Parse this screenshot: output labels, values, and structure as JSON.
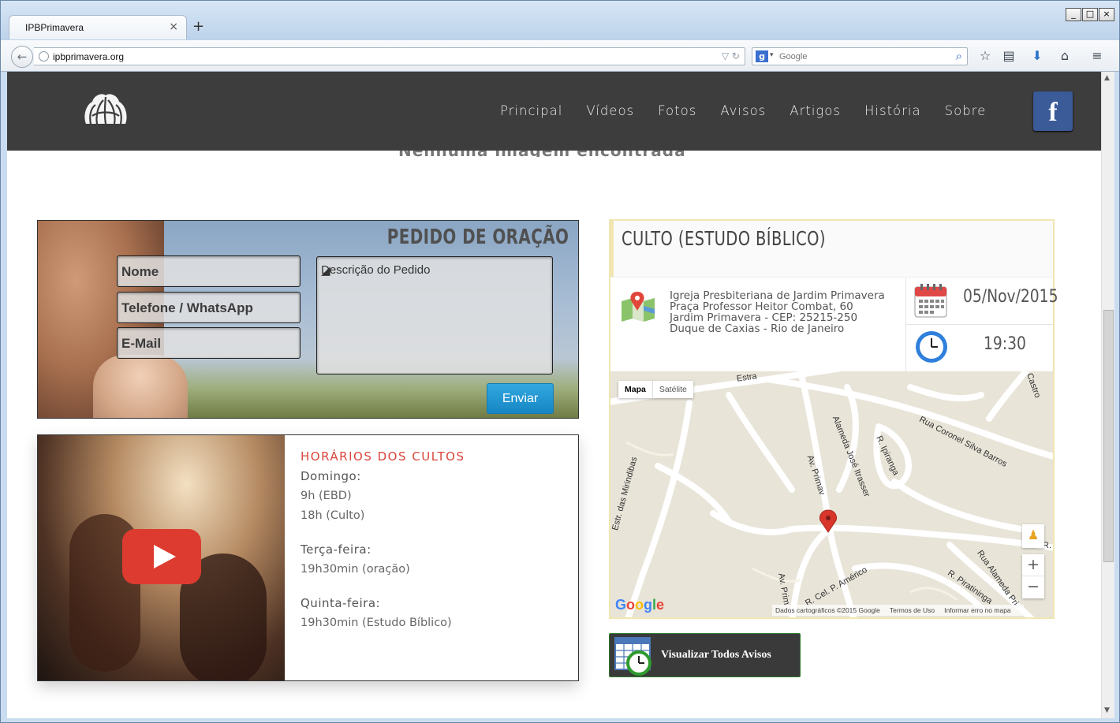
{
  "browser": {
    "tab_title": "IPBPrimavera",
    "tab_close": "×",
    "new_tab": "+",
    "url": "ipbprimavera.org",
    "search_engine": "g",
    "search_placeholder": "Google",
    "window_buttons": [
      "_",
      "□",
      "×"
    ]
  },
  "site": {
    "menu": [
      "Principal",
      "Vídeos",
      "Fotos",
      "Avisos",
      "Artigos",
      "História",
      "Sobre"
    ],
    "facebook": "f",
    "ghost_heading": "Nenhuma imagem encontrada"
  },
  "prayer": {
    "title": "PEDIDO DE ORAÇÃO",
    "name_placeholder": "Nome",
    "phone_placeholder": "Telefone / WhatsApp",
    "email_placeholder": "E-Mail",
    "description_placeholder": "Descrição do Pedido",
    "submit_label": "Enviar"
  },
  "schedule": {
    "title": "HORÁRIOS DOS CULTOS",
    "days": [
      {
        "day": "Domingo:",
        "times": [
          "9h (EBD)",
          "18h (Culto)"
        ]
      },
      {
        "day": "Terça-feira:",
        "times": [
          "19h30min (oração)"
        ]
      },
      {
        "day": "Quinta-feira:",
        "times": [
          "19h30min (Estudo Bíblico)"
        ]
      }
    ]
  },
  "event": {
    "title": "CULTO (ESTUDO BÍBLICO)",
    "address": [
      "Igreja Presbiteriana de Jardim Primavera",
      "Praça Professor Heitor Combat, 60",
      "Jardim Primavera - CEP: 25215-250",
      "Duque de Caxias - Rio de Janeiro"
    ],
    "date": "05/Nov/2015",
    "time": "19:30"
  },
  "map": {
    "type_map": "Mapa",
    "type_satellite": "Satélite",
    "labels": {
      "estrada_top": "Estra",
      "castro": "Castro",
      "coronel": "Rua Coronel Silva Barros",
      "ipiranga": "R. Ipiranga",
      "itrasser": "Alameda José Itrasser",
      "primavera1": "Av. Primav",
      "mirindibas": "Estr. das Mirindibas",
      "primavera2": "Av. Prim",
      "americo": "R. Cel. P. Américo",
      "piratininga": "R. Piratininga",
      "alameda_right": "Rua Alameda Pri",
      "r_edge": "R."
    },
    "zoom_in": "+",
    "zoom_out": "−",
    "google": [
      "G",
      "o",
      "o",
      "g",
      "l",
      "e"
    ],
    "footer": [
      "Dados cartográficos ©2015 Google",
      "Termos de Uso",
      "Informar erro no mapa"
    ]
  },
  "avisos_button": "Visualizar Todos Avisos",
  "colors": {
    "header_bg": "#3d3d3d",
    "accent_red": "#d9453a",
    "button_blue": "#1e96d4",
    "facebook_blue": "#3b5a98"
  }
}
